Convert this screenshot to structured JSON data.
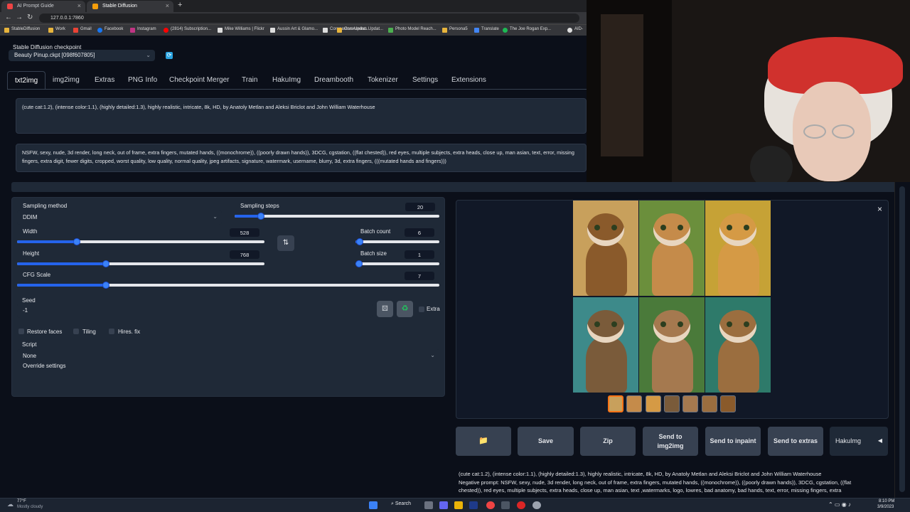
{
  "browser": {
    "tabs": [
      {
        "title": "AI Prompt Guide"
      },
      {
        "title": "Stable Diffusion"
      }
    ],
    "new_tab": "+",
    "close": "×",
    "url": "127.0.0.1:7860",
    "back": "←",
    "forward": "→",
    "reload": "↻",
    "bookmarks": [
      "StableDiffusion",
      "Work",
      "Gmail",
      "Facebook",
      "Instagram",
      "(2814) Subscription...",
      "Mike Williams | Flickr",
      "Aussin Art & Glamo...",
      "Coronavirus Updat...",
      "Photo Model Reach...",
      "Persona5",
      "Translate",
      "The Joe Rogan Exp...",
      "AID-"
    ]
  },
  "checkpoint": {
    "label": "Stable Diffusion checkpoint",
    "value": "Beauty Pinup.ckpt [098f607805]",
    "refresh": "⟳"
  },
  "tabs": [
    "txt2img",
    "img2img",
    "Extras",
    "PNG Info",
    "Checkpoint Merger",
    "Train",
    "HakuImg",
    "Dreambooth",
    "Tokenizer",
    "Settings",
    "Extensions"
  ],
  "prompt": "(cute cat:1.2), (intense color:1.1), (highly detailed:1.3), highly realistic, intricate, 8k, HD, by Anatoly Metlan and  Aleksi Briclot and  John William Waterhouse",
  "negative_prompt": "NSFW, sexy, nude, 3d render, long neck, out of frame, extra fingers, mutated hands, ((monochrome)), ((poorly drawn hands)), 3DCG, cgstation, ((flat chested)), red eyes, multiple subjects, extra heads, close up, man asian, text, error, missing fingers, extra digit, fewer digits, cropped, worst quality, low quality, normal quality, jpeg artifacts, signature, watermark, username, blurry, 3d, extra fingers, (((mutated hands and fingers)))",
  "settings": {
    "sampling_method": {
      "label": "Sampling method",
      "value": "DDIM"
    },
    "sampling_steps": {
      "label": "Sampling steps",
      "value": "20",
      "fraction": 0.13
    },
    "width": {
      "label": "Width",
      "value": "528",
      "fraction": 0.24
    },
    "height": {
      "label": "Height",
      "value": "768",
      "fraction": 0.36
    },
    "batch_count": {
      "label": "Batch count",
      "value": "6",
      "fraction": 0.05
    },
    "batch_size": {
      "label": "Batch size",
      "value": "1",
      "fraction": 0.0
    },
    "cfg_scale": {
      "label": "CFG Scale",
      "value": "7",
      "fraction": 0.21
    },
    "swap": "⇅",
    "seed": {
      "label": "Seed",
      "value": "-1"
    },
    "extra": "Extra",
    "restore_faces": "Restore faces",
    "tiling": "Tiling",
    "hires_fix": "Hires. fix",
    "script": {
      "label": "Script",
      "value": "None"
    },
    "override": "Override settings"
  },
  "gallery": {
    "close": "×",
    "cat_palette": [
      "#8a5a2b",
      "#c58b4a",
      "#d59a45",
      "#7a5b3a",
      "#a5794f",
      "#9b6e3f"
    ],
    "bg_palette": [
      "#c8a05c",
      "#6b8f3c",
      "#c6a236",
      "#3d8a8a",
      "#4a7a3a",
      "#2e7a6a"
    ]
  },
  "actions": {
    "folder": "📁",
    "save": "Save",
    "zip": "Zip",
    "send_img2img": "Send to img2img",
    "send_inpaint": "Send to inpaint",
    "send_extras": "Send to extras",
    "haku": "HakuImg",
    "haku_arrow": "◀"
  },
  "info": {
    "line1": "(cute cat:1.2), (intense color:1.1), (highly detailed:1.3), highly realistic, intricate, 8k, HD, by Anatoly Metlan and Aleksi Briclot and John William Waterhouse",
    "line2": "Negative prompt: NSFW, sexy, nude, 3d render, long neck, out of frame, extra fingers, mutated hands, ((monochrome)), ((poorly drawn hands)), 3DCG, cgstation, ((flat",
    "line3": "chested)), red eyes, multiple subjects, extra heads, close up, man asian, text ,watermarks, logo, lowres, bad anatomy, bad hands, text, error, missing fingers, extra"
  },
  "taskbar": {
    "weather_temp": "77°F",
    "weather_desc": "Mostly cloudy",
    "search": "Search",
    "time": "8:10 PM",
    "date": "3/9/2023"
  }
}
